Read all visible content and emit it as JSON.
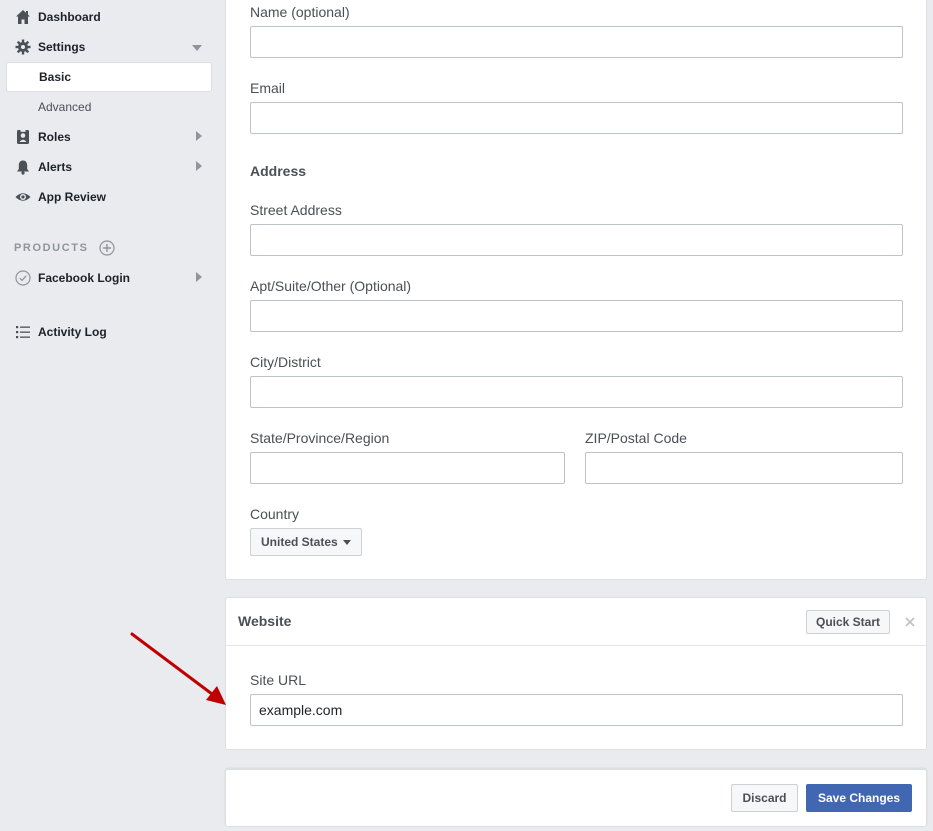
{
  "sidebar": {
    "items": [
      {
        "label": "Dashboard",
        "icon": "home-icon"
      },
      {
        "label": "Settings",
        "icon": "gear-icon",
        "expanded": true
      },
      {
        "label": "Roles",
        "icon": "roles-icon"
      },
      {
        "label": "Alerts",
        "icon": "bell-icon"
      },
      {
        "label": "App Review",
        "icon": "eye-icon"
      }
    ],
    "settings_sub": [
      {
        "label": "Basic",
        "active": true
      },
      {
        "label": "Advanced",
        "active": false
      }
    ],
    "products_label": "PRODUCTS",
    "products": [
      {
        "label": "Facebook Login",
        "icon": "check-circle-icon"
      }
    ],
    "activity_log": {
      "label": "Activity Log",
      "icon": "list-icon"
    }
  },
  "contact": {
    "name_label": "Name (optional)",
    "name_value": "",
    "email_label": "Email",
    "email_value": ""
  },
  "address": {
    "title": "Address",
    "street_label": "Street Address",
    "street_value": "",
    "apt_label": "Apt/Suite/Other (Optional)",
    "apt_value": "",
    "city_label": "City/District",
    "city_value": "",
    "state_label": "State/Province/Region",
    "state_value": "",
    "zip_label": "ZIP/Postal Code",
    "zip_value": "",
    "country_label": "Country",
    "country_value": "United States"
  },
  "website": {
    "title": "Website",
    "quick_start_label": "Quick Start",
    "site_url_label": "Site URL",
    "site_url_value": "example.com"
  },
  "footer": {
    "discard_label": "Discard",
    "save_label": "Save Changes"
  },
  "colors": {
    "primary": "#4267b2",
    "annotation_arrow": "#c00000",
    "background": "#e9ebee"
  }
}
